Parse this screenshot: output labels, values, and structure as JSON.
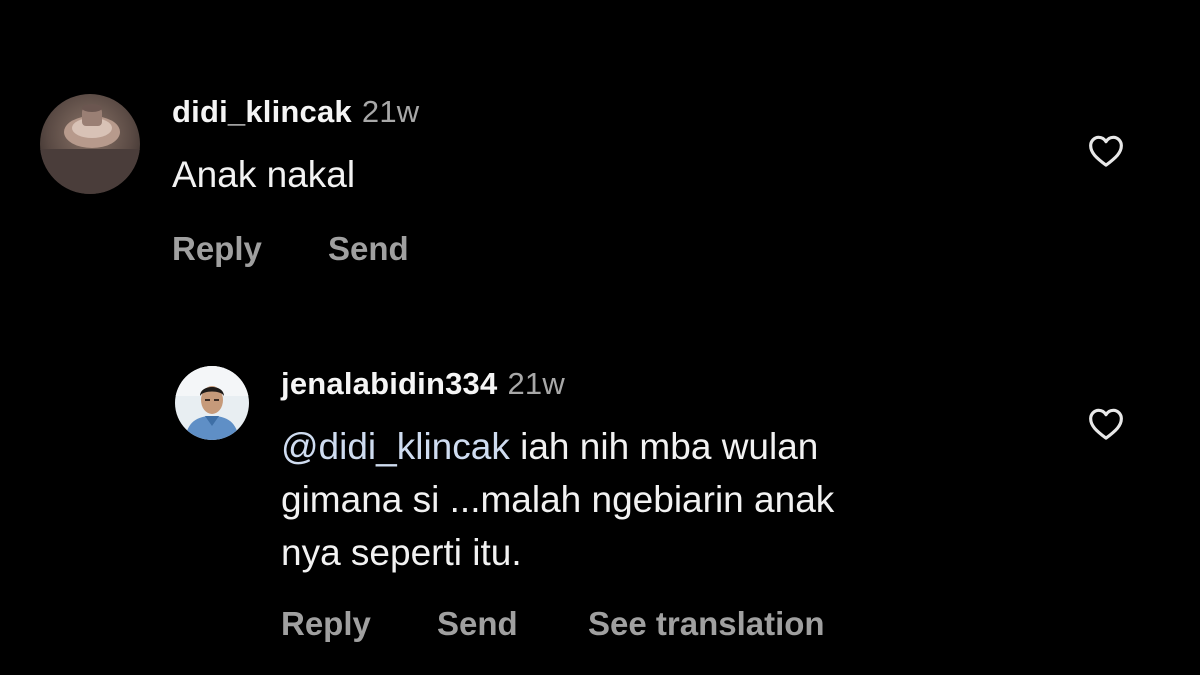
{
  "comments": [
    {
      "username": "didi_klincak",
      "time": "21w",
      "text": "Anak nakal",
      "actions": {
        "reply": "Reply",
        "send": "Send"
      }
    },
    {
      "username": "jenalabidin334",
      "time": "21w",
      "mention": "@didi_klincak",
      "text_lines": [
        " iah nih mba wulan",
        "gimana si ...malah ngebiarin anak",
        "nya seperti itu."
      ],
      "actions": {
        "reply": "Reply",
        "send": "Send",
        "translate": "See translation"
      }
    }
  ],
  "icons": {
    "like": "heart-outline-icon",
    "avatar1": "user-avatar",
    "avatar2": "user-avatar"
  },
  "colors": {
    "background": "#000000",
    "text": "#f2f2f2",
    "secondary": "#a8a8a8",
    "mention": "#cfdcf0"
  }
}
